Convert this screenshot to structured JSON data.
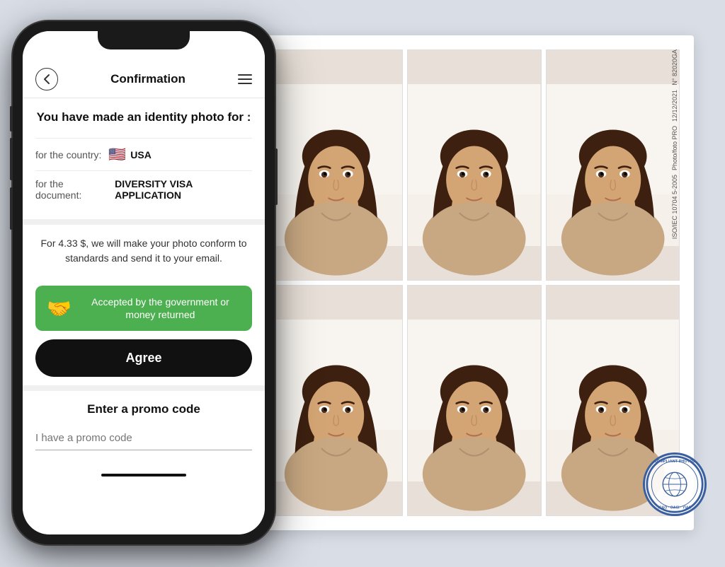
{
  "background_color": "#d8dde6",
  "phone": {
    "nav": {
      "back_label": "‹",
      "title": "Confirmation",
      "menu_aria": "Menu"
    },
    "confirmation_title": "You have made an identity photo for :",
    "country_label": "for the country:",
    "country_value": "USA",
    "country_flag": "🇺🇸",
    "document_label": "for the document:",
    "document_value": "DIVERSITY VISA APPLICATION",
    "pricing_text": "For 4.33 $, we will make your photo conform to standards and send it to your email.",
    "guarantee_text": "Accepted by the government or money returned",
    "guarantee_icon": "🤝",
    "agree_button_label": "Agree",
    "promo_title": "Enter a promo code",
    "promo_placeholder": "I have a promo code"
  },
  "photo_sheet": {
    "number_label": "N° 82020GA",
    "date_label": "12/12/2021",
    "brand_label": "Photo/foto PRO",
    "iso_label": "ISO/IEC 10704 5-2005",
    "stamp_text": "COMPLIANT PHOTOS",
    "stamp_subtext": "ICAO OACI YIAO"
  }
}
